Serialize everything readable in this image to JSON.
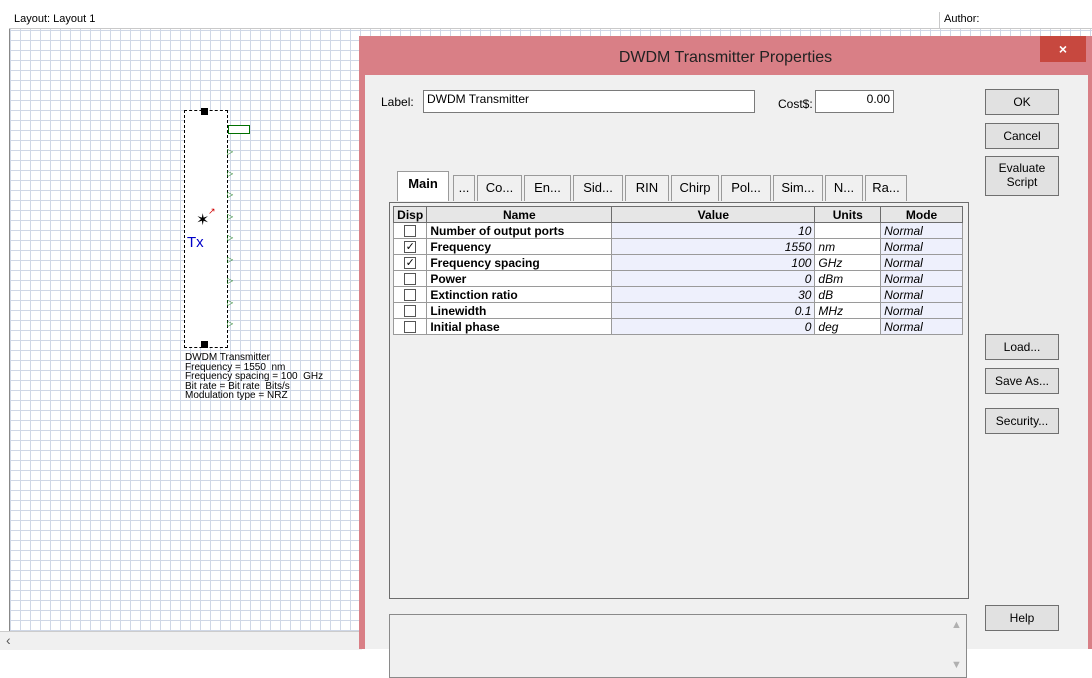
{
  "layout": {
    "title": "Layout: Layout 1",
    "author_label": "Author:"
  },
  "component": {
    "tx_label": "Tx",
    "description": "DWDM Transmitter\nFrequency = 1550  nm\nFrequency spacing = 100  GHz\nBit rate = Bit rate  Bits/s\nModulation type = NRZ",
    "output_port_count": 10
  },
  "dialog": {
    "title": "DWDM Transmitter Properties",
    "close_glyph": "×",
    "label_caption": "Label:",
    "label_value": "DWDM Transmitter",
    "cost_caption": "Cost$:",
    "cost_value": "0.00",
    "buttons": {
      "ok": "OK",
      "cancel": "Cancel",
      "evaluate_line1": "Evaluate",
      "evaluate_line2": "Script",
      "load": "Load...",
      "save_as": "Save As...",
      "security": "Security...",
      "help": "Help"
    },
    "tabs": [
      "Main",
      "...",
      "Co...",
      "En...",
      "Sid...",
      "RIN",
      "Chirp",
      "Pol...",
      "Sim...",
      "N...",
      "Ra..."
    ],
    "active_tab": "Main",
    "table": {
      "headers": [
        "Disp",
        "Name",
        "Value",
        "Units",
        "Mode"
      ],
      "rows": [
        {
          "disp": false,
          "name": "Number of output ports",
          "value": "10",
          "units": "",
          "mode": "Normal"
        },
        {
          "disp": true,
          "name": "Frequency",
          "value": "1550",
          "units": "nm",
          "mode": "Normal"
        },
        {
          "disp": true,
          "name": "Frequency spacing",
          "value": "100",
          "units": "GHz",
          "mode": "Normal"
        },
        {
          "disp": false,
          "name": "Power",
          "value": "0",
          "units": "dBm",
          "mode": "Normal"
        },
        {
          "disp": false,
          "name": "Extinction ratio",
          "value": "30",
          "units": "dB",
          "mode": "Normal"
        },
        {
          "disp": false,
          "name": "Linewidth",
          "value": "0.1",
          "units": "MHz",
          "mode": "Normal"
        },
        {
          "disp": false,
          "name": "Initial phase",
          "value": "0",
          "units": "deg",
          "mode": "Normal"
        }
      ]
    }
  },
  "icons": {
    "close": "close-icon",
    "checkmark": "check-icon",
    "scroll_up": "chevron-up-icon",
    "scroll_down": "chevron-down-icon",
    "scroll_left": "chevron-left-icon"
  },
  "colors": {
    "dialog_frame": "#d97f86",
    "close_button": "#c7483f",
    "tx_label": "#0000c8"
  }
}
